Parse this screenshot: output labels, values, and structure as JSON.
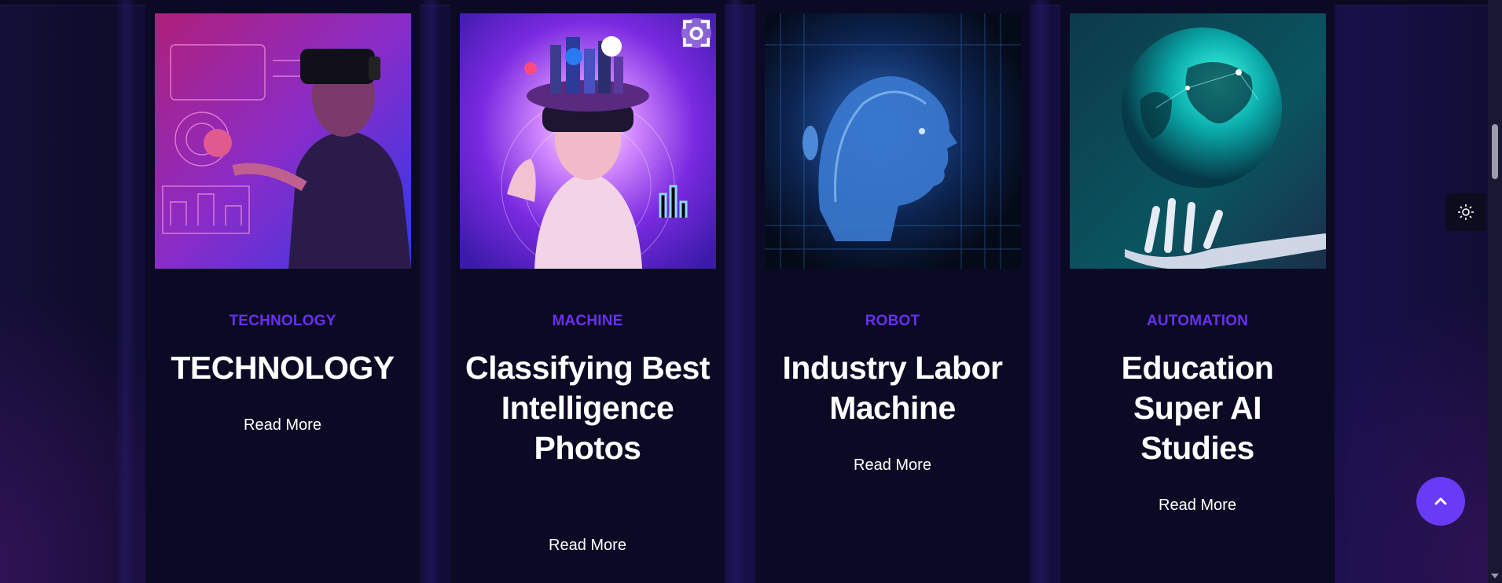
{
  "cards": [
    {
      "category": "TECHNOLOGY",
      "title": "TECHNOLOGY",
      "read_more": "Read More",
      "image": "vr-man-hologram"
    },
    {
      "category": "MACHINE",
      "title": "Classifying Best Intelligence Photos",
      "read_more": "Read More",
      "image": "vr-woman-city"
    },
    {
      "category": "ROBOT",
      "title": "Industry Labor Machine",
      "read_more": "Read More",
      "image": "digital-head"
    },
    {
      "category": "AUTOMATION",
      "title": "Education Super AI Studies",
      "read_more": "Read More",
      "image": "robot-hand-globe"
    }
  ],
  "colors": {
    "accent": "#6a2ff0",
    "button": "#6a3bf5",
    "card_bg": "#0b0a25",
    "page_bg": "#0d0b26"
  },
  "icons": {
    "theme_toggle": "sun-icon",
    "back_to_top": "chevron-up-icon",
    "image_overlay": "scan-icon"
  }
}
